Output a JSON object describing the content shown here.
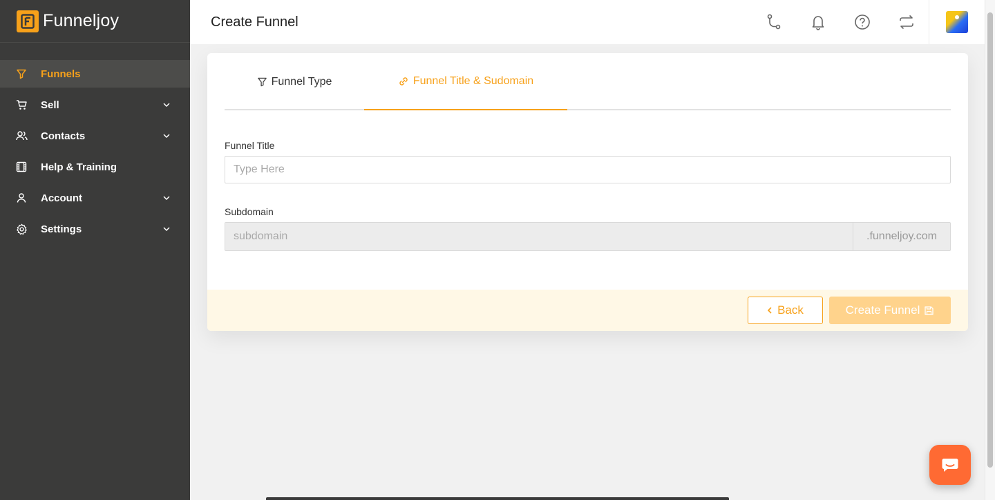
{
  "brand": {
    "name": "Funneljoy",
    "logo_letter": "F"
  },
  "colors": {
    "accent": "#f7a11a",
    "sidebar": "#3b3b3a",
    "chat": "#ff6a33"
  },
  "sidebar": {
    "items": [
      {
        "label": "Funnels",
        "icon": "filter-icon",
        "active": true,
        "has_chevron": false
      },
      {
        "label": "Sell",
        "icon": "cart-icon",
        "active": false,
        "has_chevron": true
      },
      {
        "label": "Contacts",
        "icon": "users-icon",
        "active": false,
        "has_chevron": true
      },
      {
        "label": "Help & Training",
        "icon": "film-icon",
        "active": false,
        "has_chevron": false
      },
      {
        "label": "Account",
        "icon": "user-icon",
        "active": false,
        "has_chevron": true
      },
      {
        "label": "Settings",
        "icon": "gear-icon",
        "active": false,
        "has_chevron": true
      }
    ]
  },
  "header": {
    "title": "Create Funnel",
    "icons": [
      "route-icon",
      "bell-icon",
      "help-icon",
      "switch-icon",
      "avatar"
    ]
  },
  "tabs": [
    {
      "label": "Funnel Type",
      "icon": "filter-icon",
      "active": false
    },
    {
      "label": "Funnel Title & Sudomain",
      "icon": "link-icon",
      "active": true
    }
  ],
  "form": {
    "title_label": "Funnel Title",
    "title_placeholder": "Type Here",
    "title_value": "",
    "subdomain_label": "Subdomain",
    "subdomain_placeholder": "subdomain",
    "subdomain_value": "",
    "subdomain_suffix": ".funneljoy.com"
  },
  "footer": {
    "back_label": "Back",
    "create_label": "Create Funnel"
  }
}
